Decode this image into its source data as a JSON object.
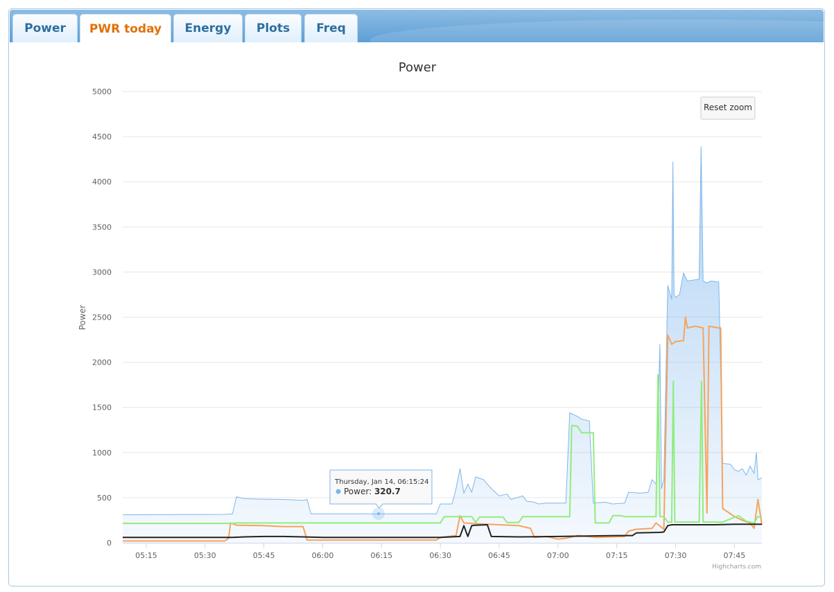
{
  "tabs": [
    {
      "label": "Power",
      "active": false
    },
    {
      "label": "PWR today",
      "active": true
    },
    {
      "label": "Energy",
      "active": false
    },
    {
      "label": "Plots",
      "active": false
    },
    {
      "label": "Freq",
      "active": false
    }
  ],
  "colors": {
    "active_tab": "#e17009",
    "inactive_tab": "#2e6e9e",
    "tabbar": "#5d9fd6",
    "series_blue": "#7cb5ec",
    "series_orange": "#f7a35c",
    "series_green": "#90ed7d",
    "series_black": "#222222"
  },
  "reset_zoom_label": "Reset zoom",
  "credits": "Highcharts.com",
  "tooltip": {
    "title": "Thursday, Jan 14, 06:15:24",
    "series_name": "Power",
    "value": "320.7"
  },
  "chart_data": {
    "type": "line",
    "title": "Power",
    "ylabel": "Power",
    "xlabel": "",
    "ylim": [
      0,
      5000
    ],
    "yticks": [
      0,
      500,
      1000,
      1500,
      2000,
      2500,
      3000,
      3500,
      4000,
      4500,
      5000
    ],
    "xlim": [
      "05:09",
      "07:52"
    ],
    "xticks": [
      "05:15",
      "05:30",
      "05:45",
      "06:00",
      "06:15",
      "06:30",
      "06:45",
      "07:00",
      "07:15",
      "07:30",
      "07:45"
    ],
    "grid": true,
    "legend": "none",
    "series": [
      {
        "color": "#7cb5ec",
        "fill": true,
        "points": [
          [
            "05:09",
            310
          ],
          [
            "05:35",
            315
          ],
          [
            "05:37",
            320
          ],
          [
            "05:38",
            510
          ],
          [
            "05:40",
            490
          ],
          [
            "05:43",
            485
          ],
          [
            "05:50",
            480
          ],
          [
            "05:55",
            470
          ],
          [
            "05:56",
            480
          ],
          [
            "05:57",
            320
          ],
          [
            "06:10",
            320
          ],
          [
            "06:29",
            320
          ],
          [
            "06:30",
            430
          ],
          [
            "06:33",
            430
          ],
          [
            "06:34",
            600
          ],
          [
            "06:35",
            820
          ],
          [
            "06:36",
            550
          ],
          [
            "06:37",
            650
          ],
          [
            "06:38",
            560
          ],
          [
            "06:39",
            730
          ],
          [
            "06:41",
            700
          ],
          [
            "06:42",
            650
          ],
          [
            "06:43",
            600
          ],
          [
            "06:44",
            560
          ],
          [
            "06:45",
            520
          ],
          [
            "06:47",
            540
          ],
          [
            "06:48",
            480
          ],
          [
            "06:51",
            520
          ],
          [
            "06:52",
            460
          ],
          [
            "06:54",
            450
          ],
          [
            "06:55",
            430
          ],
          [
            "06:57",
            440
          ],
          [
            "07:02",
            440
          ],
          [
            "07:03",
            1440
          ],
          [
            "07:05",
            1400
          ],
          [
            "07:06",
            1370
          ],
          [
            "07:08",
            1350
          ],
          [
            "07:09",
            440
          ],
          [
            "07:12",
            450
          ],
          [
            "07:14",
            430
          ],
          [
            "07:17",
            440
          ],
          [
            "07:18",
            560
          ],
          [
            "07:21",
            550
          ],
          [
            "07:23",
            560
          ],
          [
            "07:24",
            700
          ],
          [
            "07:25",
            650
          ],
          [
            "07:26",
            2200
          ],
          [
            "07:26.4",
            600
          ],
          [
            "07:27",
            700
          ],
          [
            "07:28",
            2850
          ],
          [
            "07:29",
            2700
          ],
          [
            "07:29.3",
            4220
          ],
          [
            "07:29.6",
            2750
          ],
          [
            "07:30",
            2720
          ],
          [
            "07:31",
            2750
          ],
          [
            "07:32",
            2990
          ],
          [
            "07:33",
            2900
          ],
          [
            "07:36",
            2920
          ],
          [
            "07:36.5",
            4390
          ],
          [
            "07:37",
            2900
          ],
          [
            "07:38",
            2880
          ],
          [
            "07:39",
            2900
          ],
          [
            "07:41",
            2890
          ],
          [
            "07:42",
            880
          ],
          [
            "07:44",
            870
          ],
          [
            "07:45",
            810
          ],
          [
            "07:46",
            790
          ],
          [
            "07:47",
            820
          ],
          [
            "07:48",
            750
          ],
          [
            "07:49",
            850
          ],
          [
            "07:50",
            770
          ],
          [
            "07:50.6",
            1000
          ],
          [
            "07:51",
            700
          ],
          [
            "07:52",
            720
          ]
        ]
      },
      {
        "color": "#f7a35c",
        "fill": false,
        "points": [
          [
            "05:09",
            20
          ],
          [
            "05:35",
            20
          ],
          [
            "05:36",
            50
          ],
          [
            "05:36.5",
            220
          ],
          [
            "05:38",
            195
          ],
          [
            "05:45",
            190
          ],
          [
            "05:50",
            180
          ],
          [
            "05:55",
            180
          ],
          [
            "05:56",
            30
          ],
          [
            "06:29",
            30
          ],
          [
            "06:30",
            60
          ],
          [
            "06:34",
            80
          ],
          [
            "06:35",
            300
          ],
          [
            "06:36",
            220
          ],
          [
            "06:40",
            210
          ],
          [
            "06:45",
            200
          ],
          [
            "06:50",
            190
          ],
          [
            "06:53",
            160
          ],
          [
            "06:54",
            60
          ],
          [
            "06:57",
            70
          ],
          [
            "07:00",
            40
          ],
          [
            "07:02",
            50
          ],
          [
            "07:05",
            80
          ],
          [
            "07:10",
            60
          ],
          [
            "07:17",
            70
          ],
          [
            "07:18",
            130
          ],
          [
            "07:20",
            150
          ],
          [
            "07:24",
            160
          ],
          [
            "07:25",
            220
          ],
          [
            "07:27",
            150
          ],
          [
            "07:28",
            2300
          ],
          [
            "07:29",
            2200
          ],
          [
            "07:30",
            2230
          ],
          [
            "07:32",
            2240
          ],
          [
            "07:32.5",
            2500
          ],
          [
            "07:33",
            2380
          ],
          [
            "07:35",
            2400
          ],
          [
            "07:37",
            2380
          ],
          [
            "07:38",
            330
          ],
          [
            "07:38.5",
            2400
          ],
          [
            "07:41",
            2380
          ],
          [
            "07:41.5",
            2380
          ],
          [
            "07:42",
            380
          ],
          [
            "07:45",
            290
          ],
          [
            "07:47",
            250
          ],
          [
            "07:49",
            220
          ],
          [
            "07:50",
            160
          ],
          [
            "07:51",
            480
          ],
          [
            "07:52",
            200
          ]
        ]
      },
      {
        "color": "#90ed7d",
        "fill": false,
        "points": [
          [
            "05:09",
            215
          ],
          [
            "05:37",
            215
          ],
          [
            "05:38",
            220
          ],
          [
            "06:30",
            220
          ],
          [
            "06:31",
            290
          ],
          [
            "06:38",
            290
          ],
          [
            "06:39",
            225
          ],
          [
            "06:40",
            285
          ],
          [
            "06:46",
            285
          ],
          [
            "06:47",
            225
          ],
          [
            "06:50",
            225
          ],
          [
            "06:51",
            290
          ],
          [
            "07:03",
            290
          ],
          [
            "07:03.5",
            1300
          ],
          [
            "07:05",
            1290
          ],
          [
            "07:06",
            1220
          ],
          [
            "07:09",
            1220
          ],
          [
            "07:09.5",
            220
          ],
          [
            "07:13",
            220
          ],
          [
            "07:14",
            300
          ],
          [
            "07:16",
            300
          ],
          [
            "07:17",
            290
          ],
          [
            "07:25",
            290
          ],
          [
            "07:25.5",
            1860
          ],
          [
            "07:26",
            290
          ],
          [
            "07:27",
            290
          ],
          [
            "07:28",
            230
          ],
          [
            "07:29",
            230
          ],
          [
            "07:29.4",
            1790
          ],
          [
            "07:29.8",
            230
          ],
          [
            "07:30",
            230
          ],
          [
            "07:36",
            230
          ],
          [
            "07:36.6",
            1790
          ],
          [
            "07:37",
            230
          ],
          [
            "07:42",
            230
          ],
          [
            "07:46",
            300
          ],
          [
            "07:48",
            240
          ],
          [
            "07:50",
            220
          ],
          [
            "07:51",
            290
          ],
          [
            "07:52",
            280
          ]
        ]
      },
      {
        "color": "#222222",
        "fill": false,
        "points": [
          [
            "05:09",
            60
          ],
          [
            "05:35",
            60
          ],
          [
            "05:36",
            60
          ],
          [
            "05:37",
            60
          ],
          [
            "05:40",
            65
          ],
          [
            "05:45",
            70
          ],
          [
            "05:50",
            70
          ],
          [
            "05:55",
            65
          ],
          [
            "06:00",
            60
          ],
          [
            "06:30",
            60
          ],
          [
            "06:35",
            70
          ],
          [
            "06:36",
            190
          ],
          [
            "06:37",
            70
          ],
          [
            "06:38",
            190
          ],
          [
            "06:39",
            195
          ],
          [
            "06:42",
            200
          ],
          [
            "06:43",
            70
          ],
          [
            "06:50",
            65
          ],
          [
            "07:00",
            70
          ],
          [
            "07:15",
            80
          ],
          [
            "07:19",
            80
          ],
          [
            "07:20",
            110
          ],
          [
            "07:26",
            115
          ],
          [
            "07:27",
            120
          ],
          [
            "07:28",
            190
          ],
          [
            "07:29",
            200
          ],
          [
            "07:35",
            200
          ],
          [
            "07:40",
            200
          ],
          [
            "07:45",
            205
          ],
          [
            "07:52",
            205
          ]
        ]
      }
    ]
  }
}
